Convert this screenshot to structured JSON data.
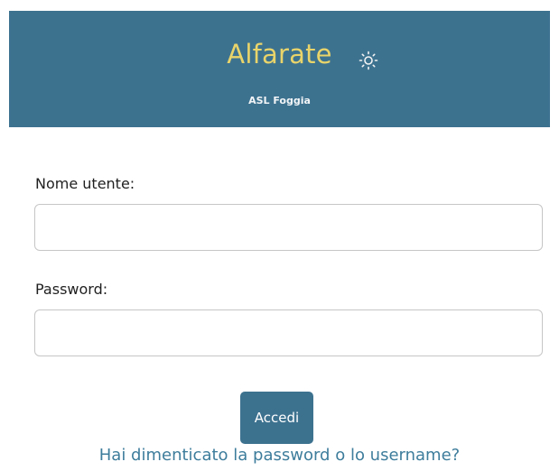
{
  "header": {
    "title": "Alfarate",
    "subtitle": "ASL Foggia",
    "theme_icon": "sun-icon"
  },
  "form": {
    "username_label": "Nome utente:",
    "username_value": "",
    "password_label": "Password:",
    "password_value": "",
    "submit_label": "Accedi",
    "forgot_link": "Hai dimenticato la password o lo username?"
  },
  "colors": {
    "header_bg": "#3d728f",
    "title": "#e9d46a",
    "button_bg": "#3d728f",
    "link": "#3e7d9c"
  }
}
